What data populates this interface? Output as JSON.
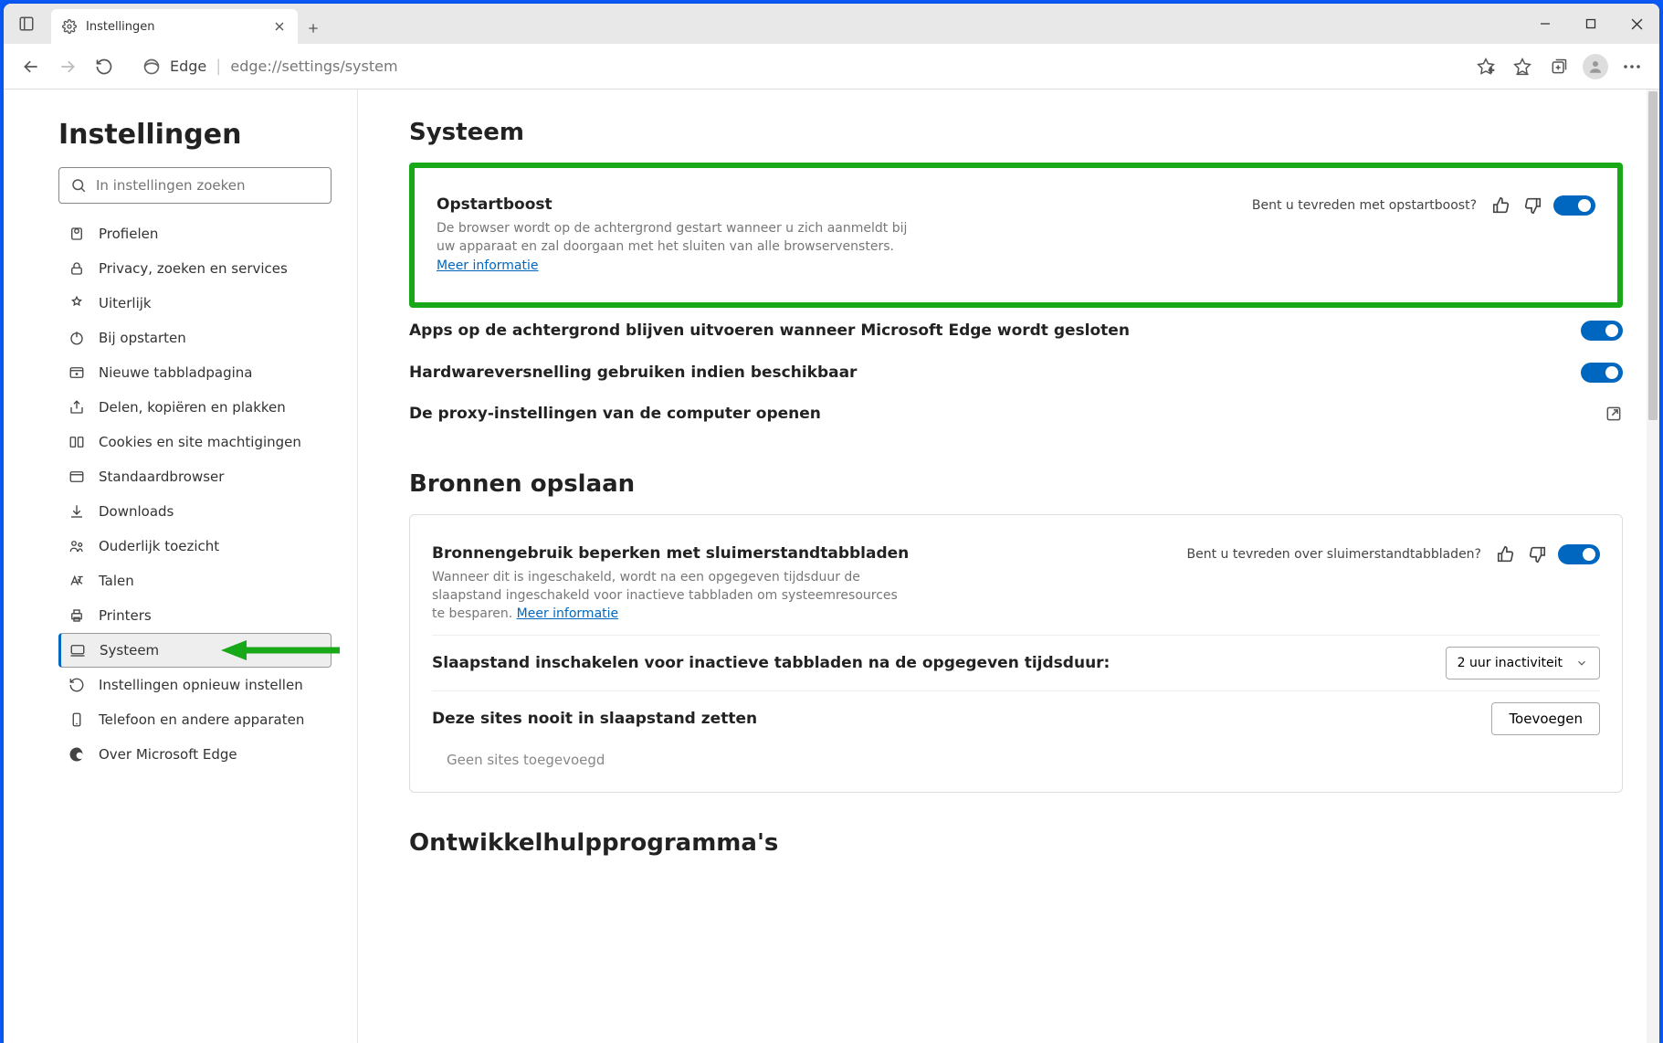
{
  "tab": {
    "title": "Instellingen"
  },
  "toolbar": {
    "edge_label": "Edge",
    "url": "edge://settings/system"
  },
  "sidebar": {
    "heading": "Instellingen",
    "search_placeholder": "In instellingen zoeken",
    "items": [
      {
        "label": "Profielen"
      },
      {
        "label": "Privacy, zoeken en services"
      },
      {
        "label": "Uiterlijk"
      },
      {
        "label": "Bij opstarten"
      },
      {
        "label": "Nieuwe tabbladpagina"
      },
      {
        "label": "Delen, kopiëren en plakken"
      },
      {
        "label": "Cookies en site machtigingen"
      },
      {
        "label": "Standaardbrowser"
      },
      {
        "label": "Downloads"
      },
      {
        "label": "Ouderlijk toezicht"
      },
      {
        "label": "Talen"
      },
      {
        "label": "Printers"
      },
      {
        "label": "Systeem"
      },
      {
        "label": "Instellingen opnieuw instellen"
      },
      {
        "label": "Telefoon en andere apparaten"
      },
      {
        "label": "Over Microsoft Edge"
      }
    ]
  },
  "main": {
    "section1_title": "Systeem",
    "startup": {
      "title": "Opstartboost",
      "desc_a": "De browser wordt op de achtergrond gestart wanneer u zich aanmeldt bij uw apparaat en zal doorgaan met het sluiten van alle browservensters. ",
      "more": "Meer informatie",
      "feedback_q": "Bent u tevreden met opstartboost?"
    },
    "bg_apps": {
      "title": "Apps op de achtergrond blijven uitvoeren wanneer Microsoft Edge wordt gesloten"
    },
    "hw_accel": {
      "title": "Hardwareversnelling gebruiken indien beschikbaar"
    },
    "proxy": {
      "title": "De proxy-instellingen van de computer openen"
    },
    "section2_title": "Bronnen opslaan",
    "sleep": {
      "title": "Bronnengebruik beperken met sluimerstandtabbladen",
      "desc_a": "Wanneer dit is ingeschakeld, wordt na een opgegeven tijdsduur de slaapstand ingeschakeld voor inactieve tabbladen om systeemresources te besparen. ",
      "more": "Meer informatie",
      "feedback_q": "Bent u tevreden over sluimerstandtabbladen?"
    },
    "sleep_timeout": {
      "title": "Slaapstand inschakelen voor inactieve tabbladen na de opgegeven tijdsduur:",
      "dropdown": "2 uur inactiviteit"
    },
    "never_sleep": {
      "title": "Deze sites nooit in slaapstand zetten",
      "add": "Toevoegen",
      "empty": "Geen sites toegevoegd"
    },
    "section3_title": "Ontwikkelhulpprogramma's"
  }
}
